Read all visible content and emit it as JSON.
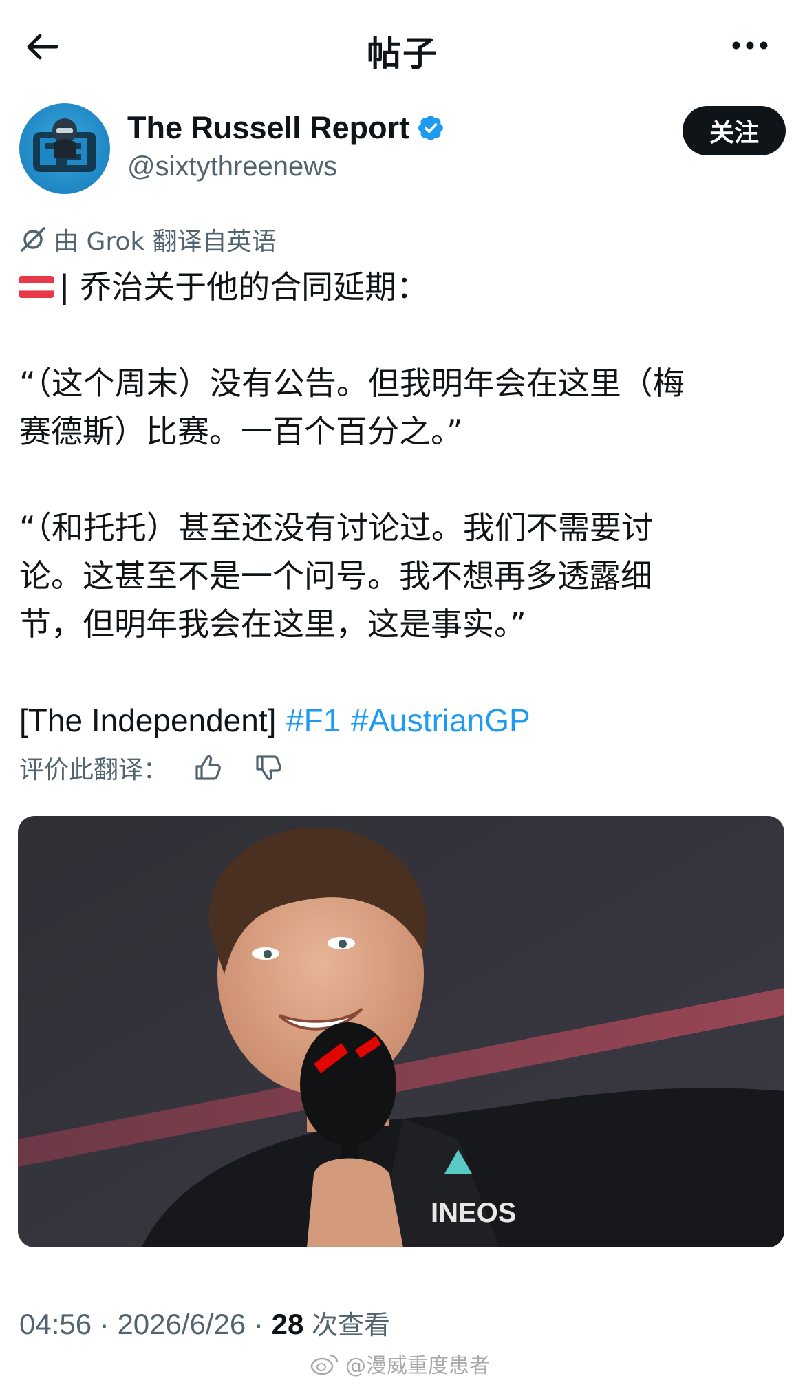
{
  "header": {
    "title": "帖子"
  },
  "author": {
    "name": "The Russell Report",
    "handle": "@sixtythreenews",
    "follow_label": "关注"
  },
  "translation": {
    "note": "由 Grok 翻译自英语"
  },
  "post": {
    "line1": "| 乔治关于他的合同延期：",
    "para2_line1": "“（这个周末）没有公告。但我明年会在这里（梅",
    "para2_line2": "赛德斯）比赛。一百个百分之。”",
    "para3_line1": "“（和托托）甚至还没有讨论过。我们不需要讨",
    "para3_line2": "论。这甚至不是一个问号。我不想再多透露细",
    "para3_line3": "节，但明年我会在这里，这是事实。”",
    "source": "[The Independent]",
    "hashtag1": "#F1",
    "hashtag2": "#AustrianGP"
  },
  "rate": {
    "label": "评价此翻译："
  },
  "meta": {
    "time": "04:56",
    "date": "2026/6/26",
    "views_count": "28",
    "views_label": "次查看"
  },
  "watermark": {
    "text": "@漫威重度患者"
  },
  "colors": {
    "link": "#1d9bf0",
    "secondary_text": "#536471",
    "primary_text": "#0f1419",
    "avatar_bg": "#1f87c4"
  }
}
